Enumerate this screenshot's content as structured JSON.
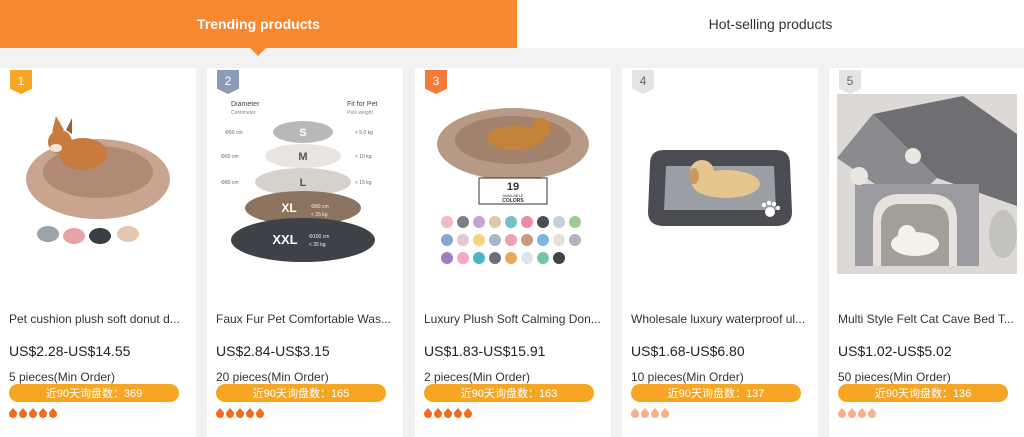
{
  "tabs": [
    {
      "label": "Trending products",
      "active": true
    },
    {
      "label": "Hot-selling products",
      "active": false
    }
  ],
  "colors": {
    "accent": "#f7882f",
    "badge": "#f6a623",
    "rating": "#f06d1f"
  },
  "products": [
    {
      "rank": "1",
      "title": "Pet cushion plush soft donut d...",
      "price": "US$2.28-US$14.55",
      "moq": "5 pieces(Min Order)",
      "inquiries": "近90天询盘数：369",
      "rating": 5
    },
    {
      "rank": "2",
      "title": "Faux Fur Pet Comfortable Was...",
      "price": "US$2.84-US$3.15",
      "moq": "20 pieces(Min Order)",
      "inquiries": "近90天询盘数：165",
      "rating": 5
    },
    {
      "rank": "3",
      "title": "Luxury Plush Soft Calming Don...",
      "price": "US$1.83-US$15.91",
      "moq": "2 pieces(Min Order)",
      "inquiries": "近90天询盘数：163",
      "rating": 5
    },
    {
      "rank": "4",
      "title": "Wholesale luxury waterproof ul...",
      "price": "US$1.68-US$6.80",
      "moq": "10 pieces(Min Order)",
      "inquiries": "近90天询盘数：137",
      "rating": 4
    },
    {
      "rank": "5",
      "title": "Multi Style Felt Cat Cave Bed T...",
      "price": "US$1.02-US$5.02",
      "moq": "50 pieces(Min Order)",
      "inquiries": "近90天询盘数：136",
      "rating": 4
    }
  ],
  "size_chart": {
    "diameter_label": "Diameter",
    "diameter_unit": "Centimeter",
    "fit_label": "Fit for Pet",
    "fit_unit": "Pets weight",
    "rows": [
      {
        "size": "S",
        "diameter": "Φ50 cm",
        "weight": "< 5.0 kg"
      },
      {
        "size": "M",
        "diameter": "Φ60 cm",
        "weight": "< 10 kg"
      },
      {
        "size": "L",
        "diameter": "Φ80 cm",
        "weight": "< 15 kg"
      },
      {
        "size": "XL",
        "diameter": "Φ80 cm",
        "weight": "< 25 kg"
      },
      {
        "size": "XXL",
        "diameter": "Φ100 cm",
        "weight": "< 35 kg"
      }
    ]
  },
  "colors_badge": {
    "count": "19",
    "line1": "AVAILABLE",
    "line2": "COLORS"
  }
}
